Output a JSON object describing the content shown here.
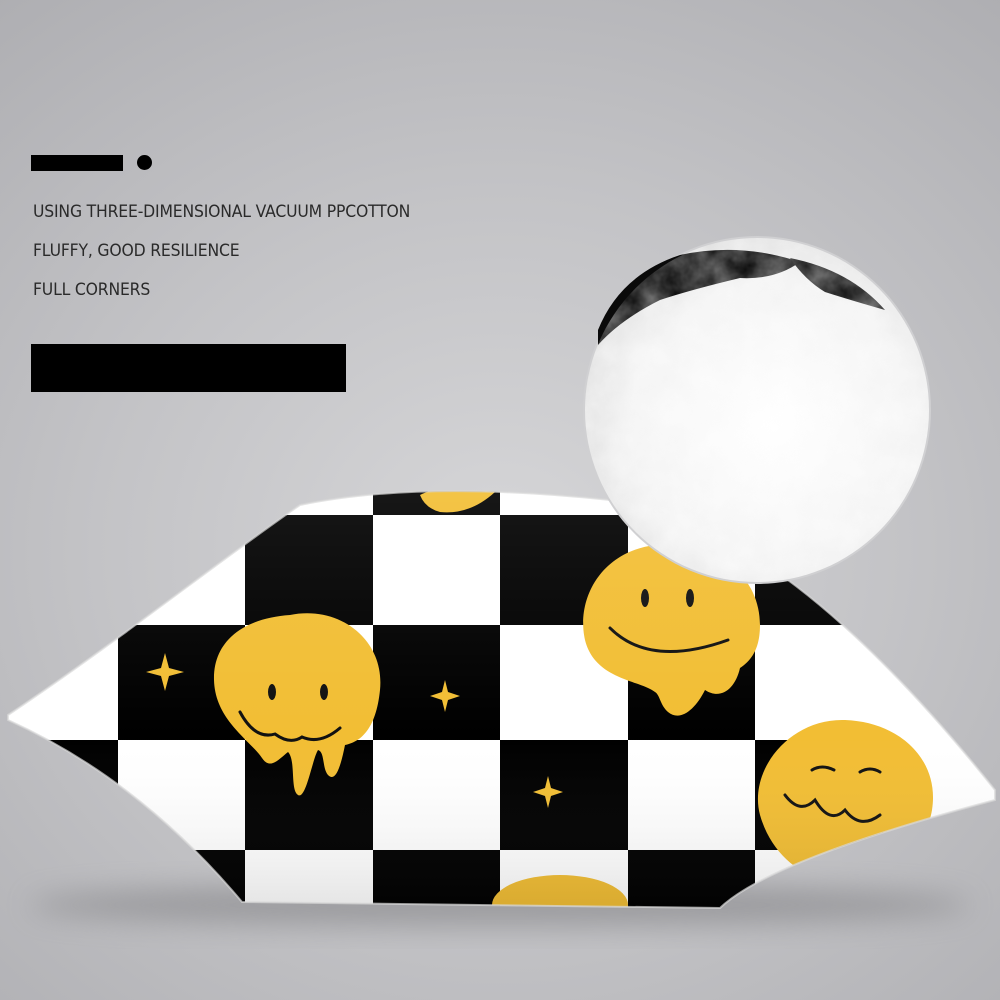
{
  "features": {
    "items": [
      "USING THREE-DIMENSIONAL VACUUM PPCOTTON",
      "FLUFFY, GOOD RESILIENCE",
      "FULL CORNERS"
    ]
  },
  "product": {
    "pattern": "black-white-checkerboard",
    "motif": "melting-smiley-face-icon",
    "motif_color": "#F2BE34",
    "check_dark": "#000000",
    "check_light": "#FFFFFF",
    "filling": "pp-cotton-fluff"
  }
}
